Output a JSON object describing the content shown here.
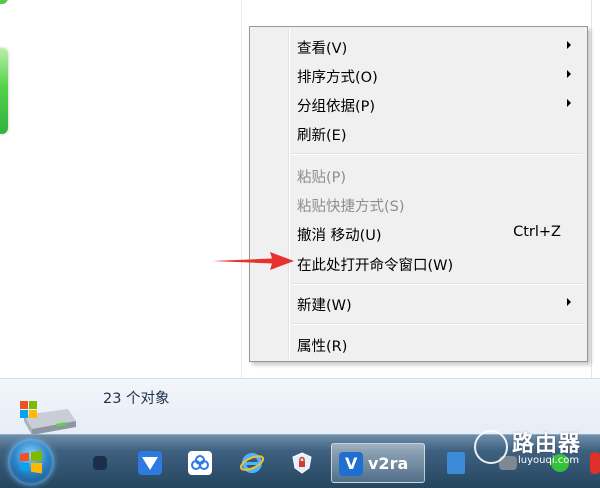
{
  "context_menu": {
    "items": [
      {
        "label": "查看(V)",
        "has_submenu": true,
        "disabled": false
      },
      {
        "label": "排序方式(O)",
        "has_submenu": true,
        "disabled": false
      },
      {
        "label": "分组依据(P)",
        "has_submenu": true,
        "disabled": false
      },
      {
        "label": "刷新(E)",
        "has_submenu": false,
        "disabled": false
      },
      {
        "label": "粘贴(P)",
        "has_submenu": false,
        "disabled": true
      },
      {
        "label": "粘贴快捷方式(S)",
        "has_submenu": false,
        "disabled": true
      },
      {
        "label": "撤消 移动(U)",
        "shortcut": "Ctrl+Z",
        "has_submenu": false,
        "disabled": false
      },
      {
        "label": "在此处打开命令窗口(W)",
        "has_submenu": false,
        "disabled": false,
        "highlighted_by_arrow": true
      },
      {
        "label": "新建(W)",
        "has_submenu": true,
        "disabled": false
      },
      {
        "label": "属性(R)",
        "has_submenu": false,
        "disabled": false
      }
    ]
  },
  "details_pane": {
    "object_count": "23 个对象",
    "icon": "drive-icon"
  },
  "taskbar": {
    "start_button": "start-orb-icon",
    "pinned": [
      "app-icon",
      "mail-bird-icon",
      "cloud-icon",
      "ie-icon",
      "shield-icon"
    ],
    "active_app_label": "v2ra",
    "tray": [
      "folder-icon",
      "network-icon",
      "wechat-icon"
    ]
  },
  "watermark": {
    "title": "路由器",
    "url": "luyouqi.com"
  },
  "colors": {
    "arrow": "#e8322d",
    "menu_bg": "#f0f0f0",
    "taskbar": "#3f6180",
    "disabled_text": "#8d8d8d"
  }
}
